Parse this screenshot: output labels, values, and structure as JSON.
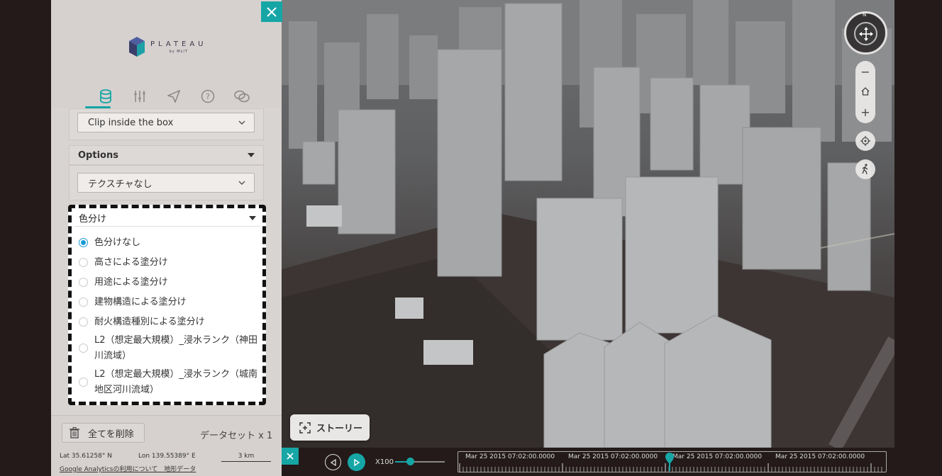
{
  "header": {
    "brand": "PLATEAU",
    "brand_sub": "by MLIT",
    "tabs": [
      "data-icon",
      "settings-icon",
      "share-icon",
      "help-icon",
      "feedback-icon"
    ]
  },
  "clip": {
    "value": "Clip inside the box"
  },
  "options": {
    "title": "Options",
    "texture_value": "テクスチャなし"
  },
  "coloring": {
    "title": "色分け",
    "items": [
      {
        "label": "色分けなし",
        "selected": true
      },
      {
        "label": "高さによる塗分け",
        "selected": false
      },
      {
        "label": "用途による塗分け",
        "selected": false
      },
      {
        "label": "建物構造による塗分け",
        "selected": false
      },
      {
        "label": "耐火構造種別による塗分け",
        "selected": false
      },
      {
        "label": "L2（想定最大規模）_浸水ランク（神田川流域）",
        "selected": false
      },
      {
        "label": "L2（想定最大規模）_浸水ランク（城南地区河川流域）",
        "selected": false
      }
    ]
  },
  "footer": {
    "delete_label": "全てを削除",
    "dataset_count": "データセット x 1"
  },
  "status": {
    "lat": "Lat  35.61258° N",
    "lon": "Lon  139.55389° E",
    "scale": "3 km",
    "links": "Google Analyticsの利用について　地形データ"
  },
  "story": {
    "label": "ストーリー"
  },
  "timeline": {
    "speed": "X100",
    "labels": [
      "Mar 25 2015 07:02:00.0000",
      "Mar 25 2015 07:02:00.0000",
      "Mar 25 2015 07:02:00.0000",
      "Mar 25 2015 07:02:00.0000"
    ]
  },
  "nav": {
    "compass_n": "N",
    "zoom_out": "−",
    "zoom_in": "+"
  },
  "colors": {
    "accent": "#16a6a6",
    "radio": "#1a9ad8"
  }
}
